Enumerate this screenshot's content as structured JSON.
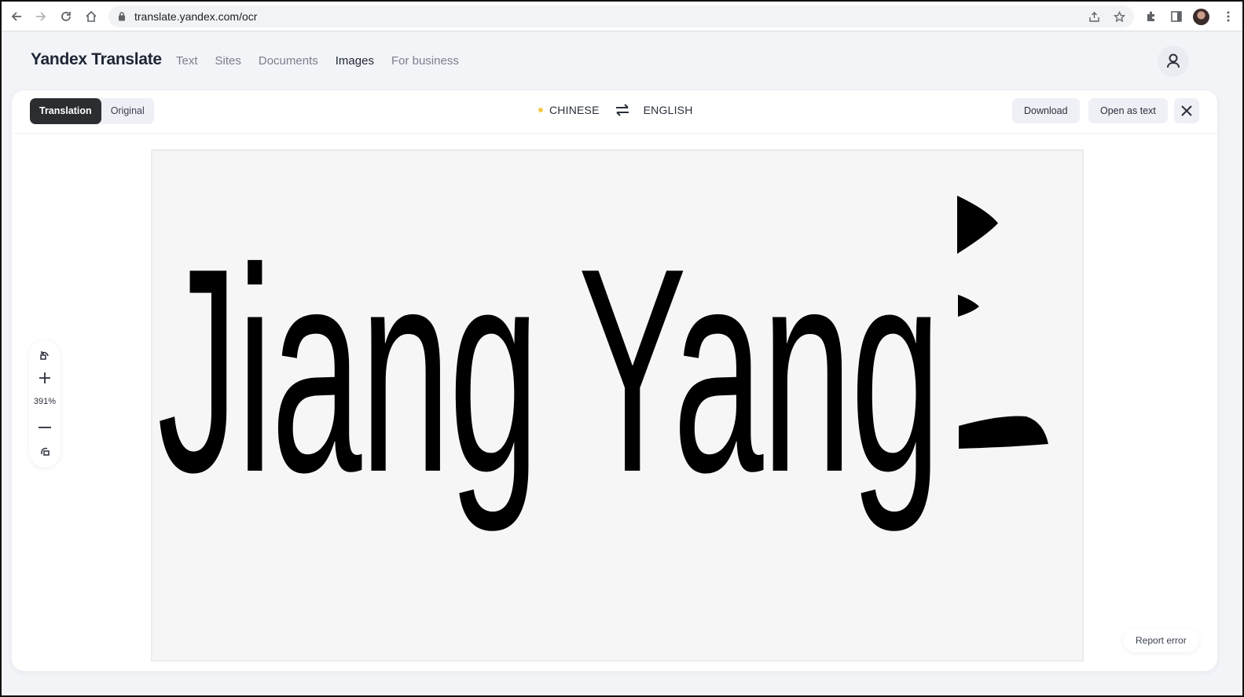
{
  "browser": {
    "url": "translate.yandex.com/ocr",
    "icons": [
      "back-icon",
      "forward-icon",
      "reload-icon",
      "home-icon",
      "lock-icon",
      "share-icon",
      "star-icon",
      "extensions-icon",
      "sidepanel-icon",
      "profile-avatar",
      "kebab-menu-icon"
    ]
  },
  "header": {
    "logo": "Yandex Translate",
    "nav": [
      {
        "label": "Text",
        "active": false
      },
      {
        "label": "Sites",
        "active": false
      },
      {
        "label": "Documents",
        "active": false
      },
      {
        "label": "Images",
        "active": true
      },
      {
        "label": "For business",
        "active": false
      }
    ],
    "user_icon": "user-icon"
  },
  "toolbar": {
    "view_modes": [
      {
        "label": "Translation",
        "selected": true
      },
      {
        "label": "Original",
        "selected": false
      }
    ],
    "source_lang": "CHINESE",
    "target_lang": "ENGLISH",
    "source_dot_color": "#f3c94a",
    "download_label": "Download",
    "open_as_text_label": "Open as text"
  },
  "viewer": {
    "translated_text": "Jiang Yang",
    "zoom_level": "391%"
  },
  "report_error_label": "Report error"
}
